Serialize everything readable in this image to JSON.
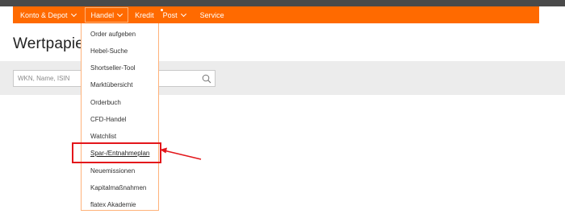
{
  "nav": {
    "items": [
      {
        "label": "Konto & Depot"
      },
      {
        "label": "Handel"
      },
      {
        "label": "Kredit"
      },
      {
        "label": "Post"
      },
      {
        "label": "Service"
      }
    ]
  },
  "page_title": "Wertpapier",
  "search": {
    "placeholder": "WKN, Name, ISIN",
    "value": ""
  },
  "dropdown": {
    "items": [
      {
        "label": "Order aufgeben"
      },
      {
        "label": "Hebel-Suche"
      },
      {
        "label": "Shortseller-Tool"
      },
      {
        "label": "Marktübersicht"
      },
      {
        "label": "Orderbuch"
      },
      {
        "label": "CFD-Handel"
      },
      {
        "label": "Watchlist"
      },
      {
        "label": "Spar-/Entnahmeplan"
      },
      {
        "label": "Neuemissionen"
      },
      {
        "label": "Kapitalmaßnahmen"
      },
      {
        "label": "flatex Akademie"
      }
    ]
  },
  "colors": {
    "nav_bg": "#ff6a00",
    "highlight": "#e3161b",
    "topbar": "#4a4a4a"
  }
}
